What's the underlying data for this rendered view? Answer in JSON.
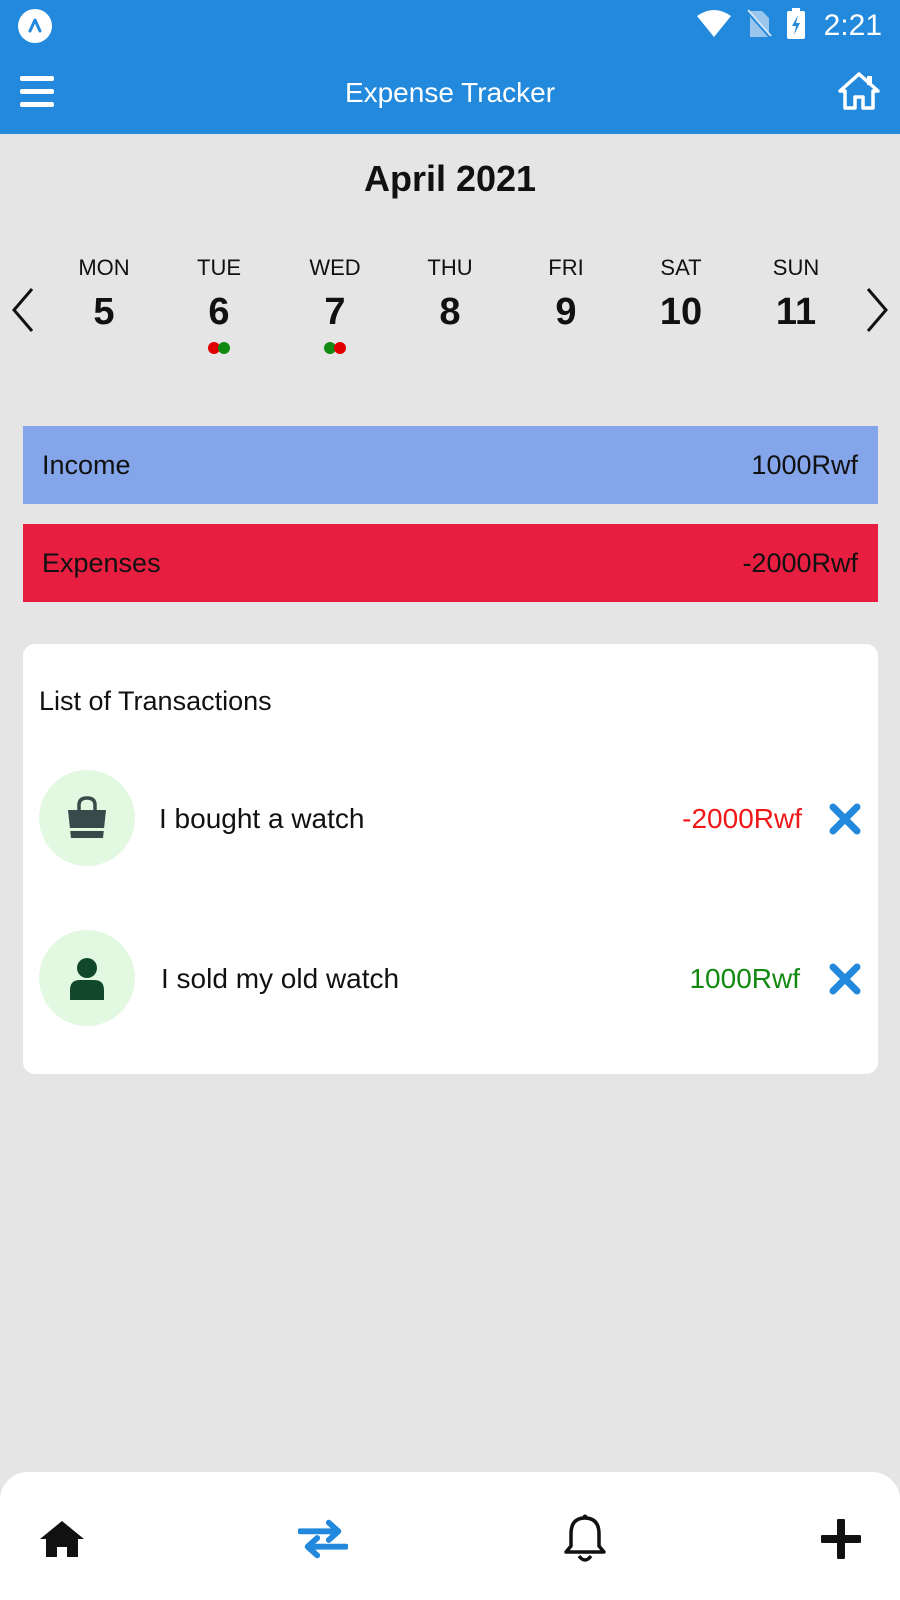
{
  "status_bar": {
    "time": "2:21",
    "icons": [
      "app-badge-icon",
      "wifi-icon",
      "no-sim-icon",
      "battery-charging-icon"
    ]
  },
  "app_bar": {
    "title": "Expense Tracker",
    "left_icon": "menu-icon",
    "right_icon": "home-icon"
  },
  "calendar": {
    "month_label": "April 2021",
    "days": [
      {
        "name": "MON",
        "num": "5",
        "dots": []
      },
      {
        "name": "TUE",
        "num": "6",
        "dots": [
          "#e00000",
          "#128a12"
        ]
      },
      {
        "name": "WED",
        "num": "7",
        "dots": [
          "#128a12",
          "#e00000"
        ]
      },
      {
        "name": "THU",
        "num": "8",
        "dots": []
      },
      {
        "name": "FRI",
        "num": "9",
        "dots": []
      },
      {
        "name": "SAT",
        "num": "10",
        "dots": []
      },
      {
        "name": "SUN",
        "num": "11",
        "dots": []
      }
    ]
  },
  "summary": {
    "income": {
      "label": "Income",
      "value": "1000Rwf",
      "color": "#85a5ea"
    },
    "expenses": {
      "label": "Expenses",
      "value": "-2000Rwf",
      "color": "#e81e41"
    }
  },
  "transactions": {
    "heading": "List of Transactions",
    "items": [
      {
        "description": "I bought a watch",
        "amount": "-2000Rwf",
        "amount_color": "#f01818",
        "icon": "shopping-bag-icon"
      },
      {
        "description": "I sold my old watch",
        "amount": "1000Rwf",
        "amount_color": "#128a12",
        "icon": "user-icon"
      }
    ]
  },
  "bottom_nav": {
    "items": [
      "home-icon",
      "transfer-icon",
      "bell-icon",
      "plus-icon"
    ],
    "active_color": "#2389dd"
  }
}
